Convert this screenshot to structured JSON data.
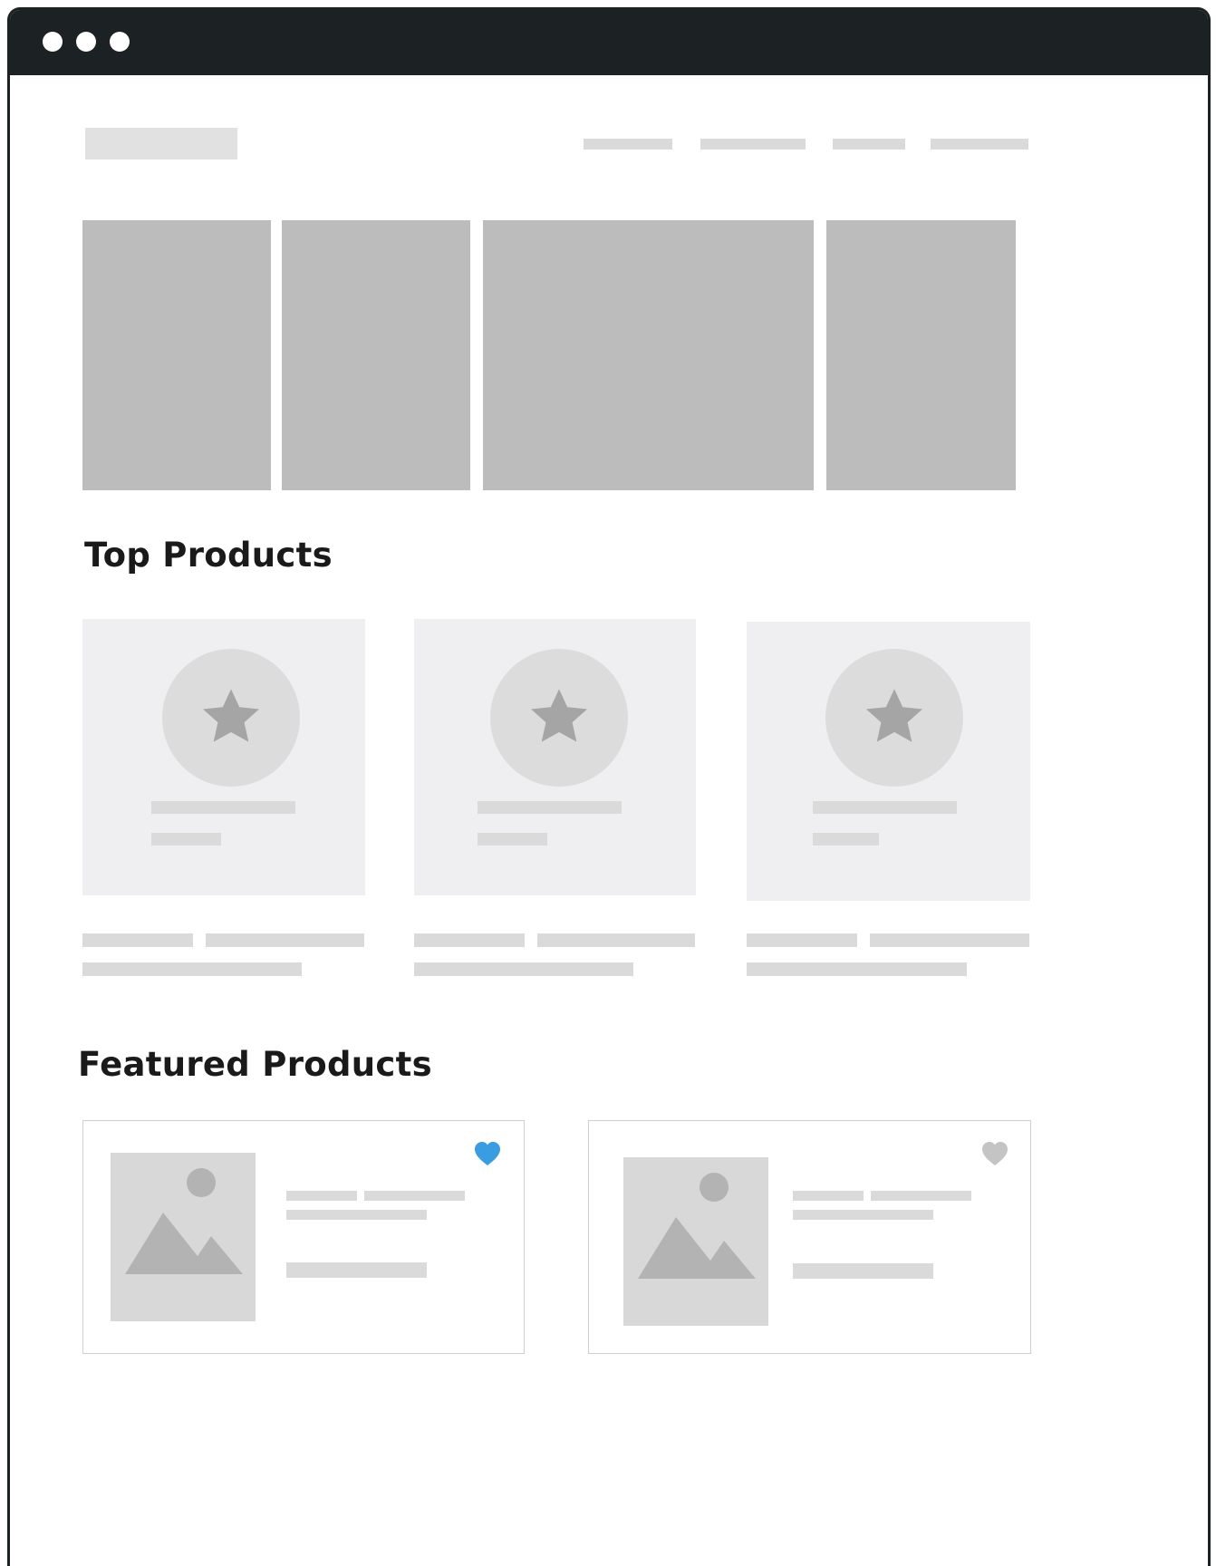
{
  "sections": {
    "top_products": {
      "title": "Top Products"
    },
    "featured_products": {
      "title": "Featured Products"
    }
  },
  "colors": {
    "titlebar": "#1c2124",
    "placeholder": "#dadada",
    "hero_placeholder": "#bcbcbc",
    "card_background": "#efeff1",
    "heart_active": "#3b9de1",
    "heart_inactive": "#c4c4c4"
  },
  "icons": {
    "window_controls": "three-dot-icon",
    "top_product": "star-icon",
    "featured_image": "image-icon",
    "favorite": "heart-icon"
  },
  "featured": [
    {
      "favorited": true
    },
    {
      "favorited": false
    }
  ]
}
